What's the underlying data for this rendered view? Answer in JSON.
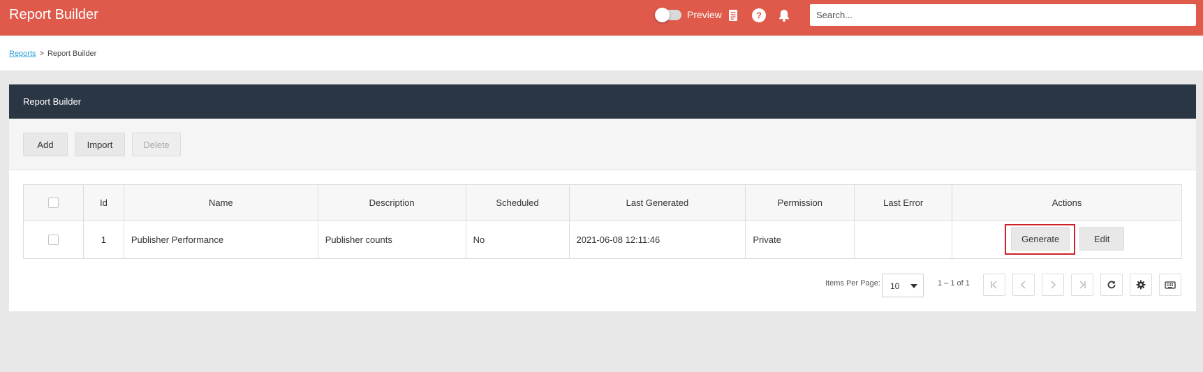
{
  "header": {
    "title": "Report Builder",
    "preview_label": "Preview",
    "search_placeholder": "Search...",
    "icons": [
      "report-icon",
      "help-icon",
      "bell-icon"
    ],
    "colors": {
      "bar": "#e05a4b"
    }
  },
  "breadcrumb": {
    "parent": "Reports",
    "separator": ">",
    "current": "Report Builder"
  },
  "panel": {
    "title": "Report Builder",
    "toolbar": {
      "add": "Add",
      "import": "Import",
      "delete": "Delete"
    }
  },
  "table": {
    "columns": [
      "Id",
      "Name",
      "Description",
      "Scheduled",
      "Last Generated",
      "Permission",
      "Last Error",
      "Actions"
    ],
    "rows": [
      {
        "id": "1",
        "name": "Publisher Performance",
        "description": "Publisher counts",
        "scheduled": "No",
        "last_generated": "2021-06-08 12:11:46",
        "permission": "Private",
        "last_error": "",
        "actions": {
          "generate": "Generate",
          "edit": "Edit"
        }
      }
    ]
  },
  "pager": {
    "items_per_page_label": "Items Per Page:",
    "items_per_page": "10",
    "range": "1 – 1 of 1"
  }
}
